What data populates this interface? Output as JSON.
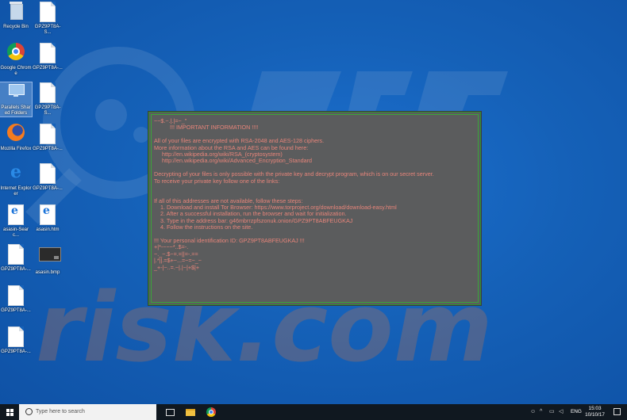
{
  "desktop": {
    "icons": [
      {
        "name": "recycle-bin",
        "label": "Recycle Bin",
        "type": "bin"
      },
      {
        "name": "file-1",
        "label": "GPZ9PT8A-S...",
        "type": "doc"
      },
      {
        "name": "google-chrome",
        "label": "Google Chrome",
        "type": "chrome"
      },
      {
        "name": "file-2",
        "label": "GPZ9PT8A-...",
        "type": "doc"
      },
      {
        "name": "parallels-shared-folders",
        "label": "Parallels Shared Folders",
        "type": "parallels"
      },
      {
        "name": "file-3",
        "label": "GPZ9PT8A-S...",
        "type": "doc"
      },
      {
        "name": "mozilla-firefox",
        "label": "Mozilla Firefox",
        "type": "firefox"
      },
      {
        "name": "file-4",
        "label": "GPZ9PT8A-...",
        "type": "doc"
      },
      {
        "name": "internet-explorer",
        "label": "Internet Explorer",
        "type": "ie"
      },
      {
        "name": "file-5",
        "label": "GPZ9PT8A-...",
        "type": "doc"
      },
      {
        "name": "asasin-search",
        "label": "asasin-Searc...",
        "type": "iedoc"
      },
      {
        "name": "asasin-htm",
        "label": "asasin.htm",
        "type": "iedoc"
      },
      {
        "name": "file-6",
        "label": "GPZ9PT8A-...",
        "type": "doc"
      },
      {
        "name": "asasin-bmp",
        "label": "asasin.bmp",
        "type": "bmp"
      },
      {
        "name": "file-7",
        "label": "GPZ9PT8A-...",
        "type": "doc"
      },
      {
        "name": "file-8",
        "label": "GPZ9PT8A-...",
        "type": "doc"
      }
    ]
  },
  "ransom_note": {
    "lines": [
      "~~$.~.|.|=~_\"",
      "          !!! IMPORTANT INFORMATION !!!!",
      "",
      "All of your files are encrypted with RSA-2048 and AES-128 ciphers.",
      "More information about the RSA and AES can be found here:",
      "     http://en.wikipedia.org/wiki/RSA_(cryptosystem)",
      "     http://en.wikipedia.org/wiki/Advanced_Encryption_Standard",
      "",
      "Decrypting of your files is only possible with the private key and decrypt program, which is on our secret server.",
      "To receive your private key follow one of the links:",
      "",
      "",
      "If all of this addresses are not available, follow these steps:",
      "    1. Download and install Tor Browser: https://www.torproject.org/download/download-easy.html",
      "    2. After a successful installation, run the browser and wait for initialization.",
      "    3. Type in the address bar: g46mbrrzpfszonuk.onion/GPZ9PT8ABFEUGKAJ",
      "    4. Follow the instructions on the site.",
      "",
      "!!! Your personal identification ID: GPZ9PT8ABFEUGKAJ !!!",
      "+|*-~~~*..$=-.",
      "~._~.$~=.=||=-.==",
      "|.*||.=$+~...=~=~_~",
      "_+-|~..=.~|.|~|+$|+"
    ]
  },
  "taskbar": {
    "search_placeholder": "Type here to search",
    "language": "ENG",
    "time": "15:03",
    "date": "10/10/17"
  },
  "colors": {
    "desktop": "#1561b8",
    "note_background": "#5b5c5d",
    "note_text": "#e8857a",
    "note_border": "#3aa53a",
    "taskbar": "#101820"
  }
}
